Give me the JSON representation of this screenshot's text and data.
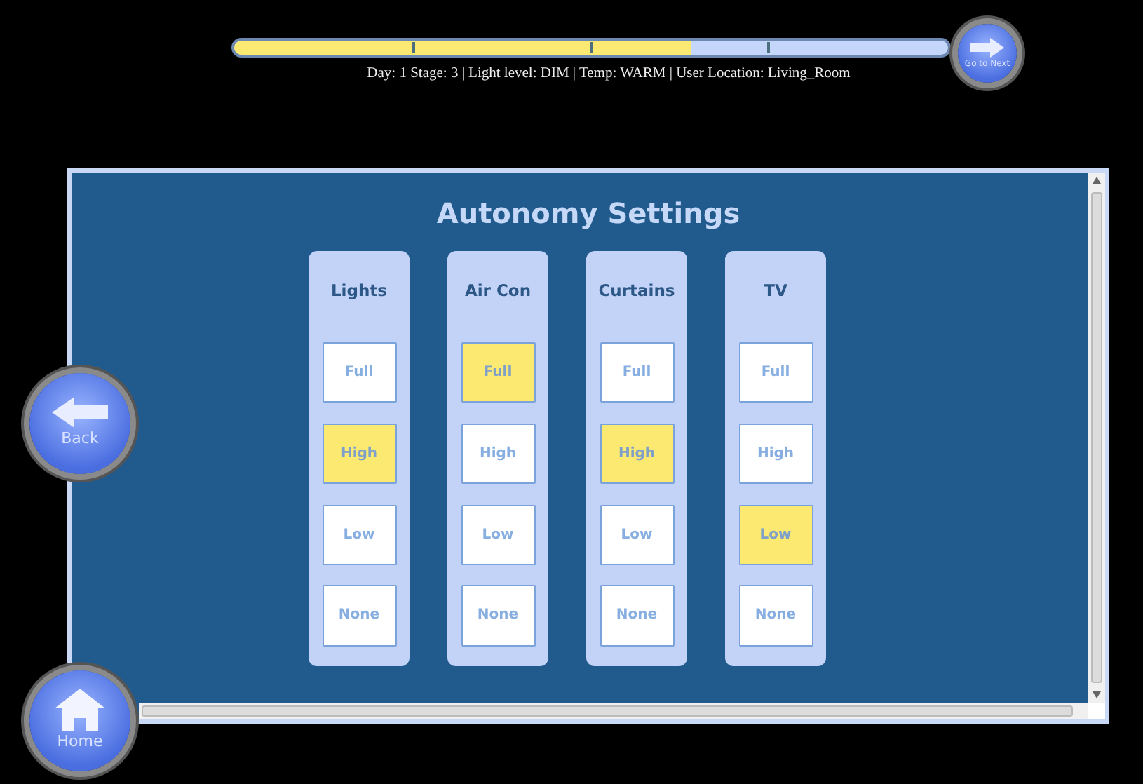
{
  "progress": {
    "level": 0.64
  },
  "status_text": "Day: 1 Stage: 3 | Light level: DIM | Temp: WARM | User Location: Living_Room",
  "next_button": {
    "label": "Go to Next"
  },
  "back_button": {
    "label": "Back"
  },
  "home_button": {
    "label": "Home"
  },
  "title": "Autonomy Settings",
  "devices": [
    {
      "name": "Lights",
      "options": [
        {
          "label": "Full",
          "selected": false
        },
        {
          "label": "High",
          "selected": true
        },
        {
          "label": "Low",
          "selected": false
        },
        {
          "label": "None",
          "selected": false
        }
      ]
    },
    {
      "name": "Air Con",
      "options": [
        {
          "label": "Full",
          "selected": true
        },
        {
          "label": "High",
          "selected": false
        },
        {
          "label": "Low",
          "selected": false
        },
        {
          "label": "None",
          "selected": false
        }
      ]
    },
    {
      "name": "Curtains",
      "options": [
        {
          "label": "Full",
          "selected": false
        },
        {
          "label": "High",
          "selected": true
        },
        {
          "label": "Low",
          "selected": false
        },
        {
          "label": "None",
          "selected": false
        }
      ]
    },
    {
      "name": "TV",
      "options": [
        {
          "label": "Full",
          "selected": false
        },
        {
          "label": "High",
          "selected": false
        },
        {
          "label": "Low",
          "selected": true
        },
        {
          "label": "None",
          "selected": false
        }
      ]
    }
  ]
}
